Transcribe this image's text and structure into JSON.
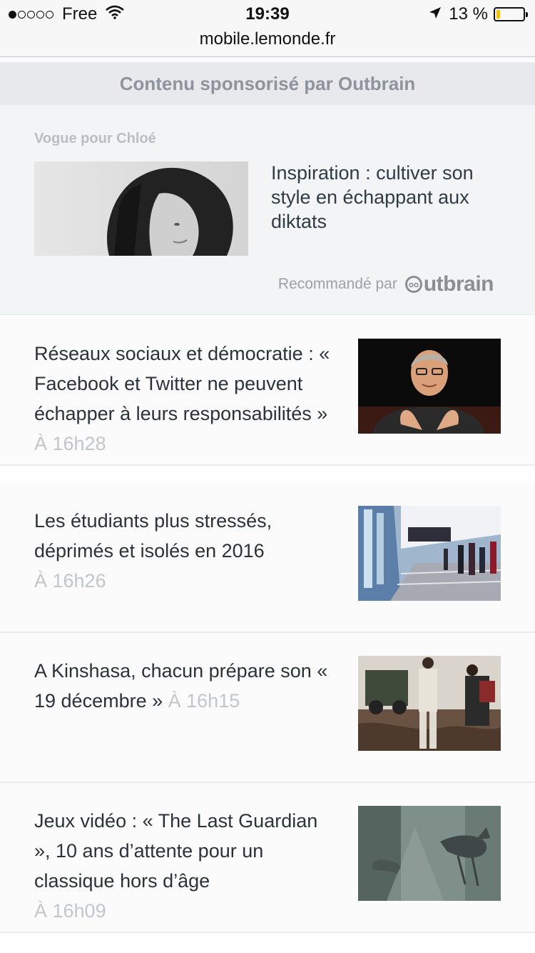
{
  "status_bar": {
    "carrier": "Free",
    "time": "19:39",
    "battery_percent": "13 %",
    "battery_level": 0.13,
    "signal_dots_filled": 1,
    "signal_dots_total": 5
  },
  "url_bar": {
    "url": "mobile.lemonde.fr"
  },
  "sponsored": {
    "header": "Contenu sponsorisé par Outbrain",
    "source": "Vogue pour Chloé",
    "title": "Inspiration : cultiver son style en échappant aux diktats",
    "recommended_label": "Recommandé par",
    "brand": "utbrain"
  },
  "articles": [
    {
      "title": "Réseaux sociaux et démocratie : « Facebook et Twitter ne peuvent échapper à leurs responsabilités »",
      "time": "À 16h28"
    },
    {
      "title": "Les étudiants plus stressés, déprimés et isolés en 2016",
      "time": "À 16h26"
    },
    {
      "title": "A Kinshasa, chacun prépare son « 19 décembre »",
      "time": "À 16h15"
    },
    {
      "title": "Jeux vidéo : « The Last Guardian », 10 ans d’attente pour un classique hors d’âge",
      "time": "À 16h09"
    }
  ],
  "colors": {
    "battery_fill": "#f5c000",
    "sponsor_header_bg": "#e7e9ec",
    "sponsor_block_bg": "#f3f4f6",
    "timestamp": "#c2c6ca"
  },
  "icons": [
    "wifi-icon",
    "location-arrow-icon",
    "battery-icon",
    "outbrain-logo-icon"
  ]
}
